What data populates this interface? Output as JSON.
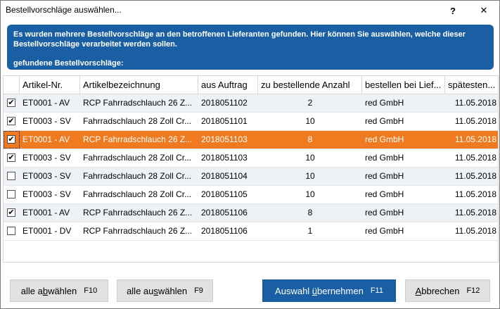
{
  "window": {
    "title": "Bestellvorschläge auswählen...",
    "help_label": "?",
    "close_label": "✕"
  },
  "banner": {
    "message": "Es wurden mehrere Bestellvorschläge an den betroffenen Lieferanten gefunden. Hier können Sie auswählen, welche dieser Bestellvorschläge verarbeitet werden sollen.",
    "found_label": "gefundene Bestellvorschläge:"
  },
  "table": {
    "columns": [
      "Artikel-Nr.",
      "Artikelbezeichnung",
      "aus Auftrag",
      "zu bestellende Anzahl",
      "bestellen bei Lief...",
      "spätesten..."
    ],
    "rows": [
      {
        "checked": true,
        "artikel_nr": "ET0001 - AV",
        "bezeichnung": "RCP Fahrradschlauch 26 Z...",
        "auftrag": "2018051102",
        "anzahl": "2",
        "lieferant": "red GmbH",
        "datum": "11.05.2018"
      },
      {
        "checked": true,
        "artikel_nr": "ET0003 - SV",
        "bezeichnung": "Fahrradschlauch 28 Zoll Cr...",
        "auftrag": "2018051101",
        "anzahl": "10",
        "lieferant": "red GmbH",
        "datum": "11.05.2018"
      },
      {
        "checked": true,
        "artikel_nr": "ET0001 - AV",
        "bezeichnung": "RCP Fahrradschlauch 26 Z...",
        "auftrag": "2018051103",
        "anzahl": "8",
        "lieferant": "red GmbH",
        "datum": "11.05.2018"
      },
      {
        "checked": true,
        "artikel_nr": "ET0003 - SV",
        "bezeichnung": "Fahrradschlauch 28 Zoll Cr...",
        "auftrag": "2018051103",
        "anzahl": "10",
        "lieferant": "red GmbH",
        "datum": "11.05.2018"
      },
      {
        "checked": false,
        "artikel_nr": "ET0003 - SV",
        "bezeichnung": "Fahrradschlauch 28 Zoll Cr...",
        "auftrag": "2018051104",
        "anzahl": "10",
        "lieferant": "red GmbH",
        "datum": "11.05.2018"
      },
      {
        "checked": false,
        "artikel_nr": "ET0003 - SV",
        "bezeichnung": "Fahrradschlauch 28 Zoll Cr...",
        "auftrag": "2018051105",
        "anzahl": "10",
        "lieferant": "red GmbH",
        "datum": "11.05.2018"
      },
      {
        "checked": true,
        "artikel_nr": "ET0001 - AV",
        "bezeichnung": "RCP Fahrradschlauch 26 Z...",
        "auftrag": "2018051106",
        "anzahl": "8",
        "lieferant": "red GmbH",
        "datum": "11.05.2018"
      },
      {
        "checked": false,
        "artikel_nr": "ET0001 - DV",
        "bezeichnung": "RCP Fahrradschlauch 26 Z...",
        "auftrag": "2018051106",
        "anzahl": "1",
        "lieferant": "red GmbH",
        "datum": "11.05.2018"
      }
    ],
    "selected_row": 2,
    "selection_color": "#f07a20"
  },
  "buttons": {
    "deselect_all": {
      "label_pre": "alle a",
      "label_u": "b",
      "label_post": "wählen",
      "key": "F10"
    },
    "select_all": {
      "label_pre": "alle au",
      "label_u": "s",
      "label_post": "wählen",
      "key": "F9"
    },
    "apply": {
      "label_pre": "Auswahl ",
      "label_u": "ü",
      "label_post": "bernehmen",
      "key": "F11"
    },
    "cancel": {
      "label_pre": "",
      "label_u": "A",
      "label_post": "bbrechen",
      "key": "F12"
    }
  },
  "colors": {
    "accent": "#1a5fa3",
    "selection": "#f07a20"
  }
}
